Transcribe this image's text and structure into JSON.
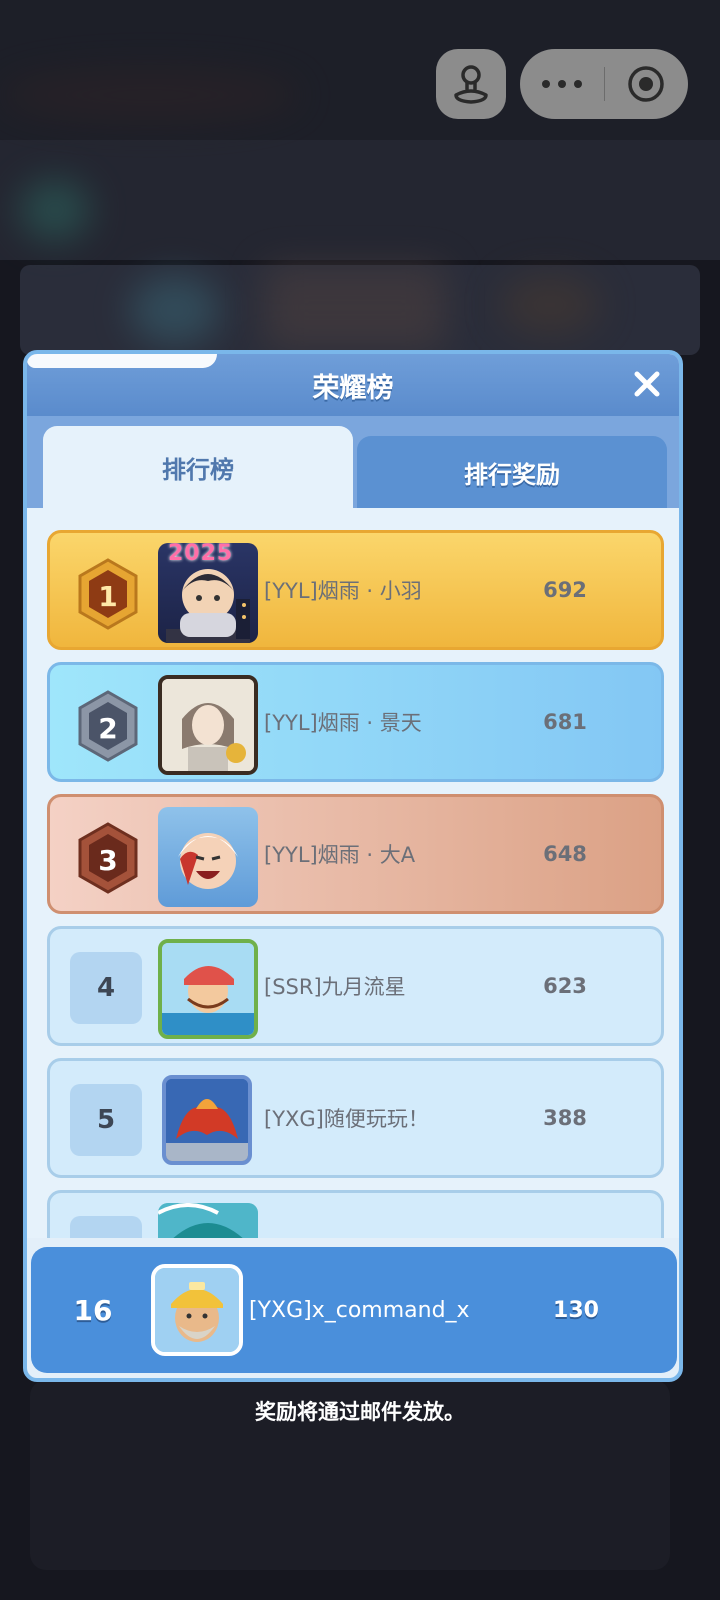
{
  "capsule": {
    "menu_icon": "more-icon",
    "close_icon": "record-icon",
    "extra_icon": "joystick-icon"
  },
  "modal": {
    "title": "荣耀榜",
    "close_icon": "close-icon",
    "tabs": [
      {
        "label": "排行榜",
        "active": true
      },
      {
        "label": "排行奖励",
        "active": false
      }
    ],
    "rows": [
      {
        "rank": "1",
        "name": "[YYL]烟雨 · 小羽",
        "score": "692",
        "avatar_badge": "2025"
      },
      {
        "rank": "2",
        "name": "[YYL]烟雨 · 景天",
        "score": "681"
      },
      {
        "rank": "3",
        "name": "[YYL]烟雨 · 大A",
        "score": "648"
      },
      {
        "rank": "4",
        "name": "[SSR]九月流星",
        "score": "623"
      },
      {
        "rank": "5",
        "name": "[YXG]随便玩玩！",
        "score": "388"
      }
    ],
    "self_row": {
      "rank": "16",
      "name": "[YXG]x_command_x",
      "score": "130"
    }
  },
  "footer": {
    "note": "奖励将通过邮件发放。"
  },
  "colors": {
    "gold": "#f0b63d",
    "silver": "#83c7f4",
    "bronze": "#dba185",
    "header": "#5a8bcc",
    "self_row": "#4a8fdb"
  }
}
